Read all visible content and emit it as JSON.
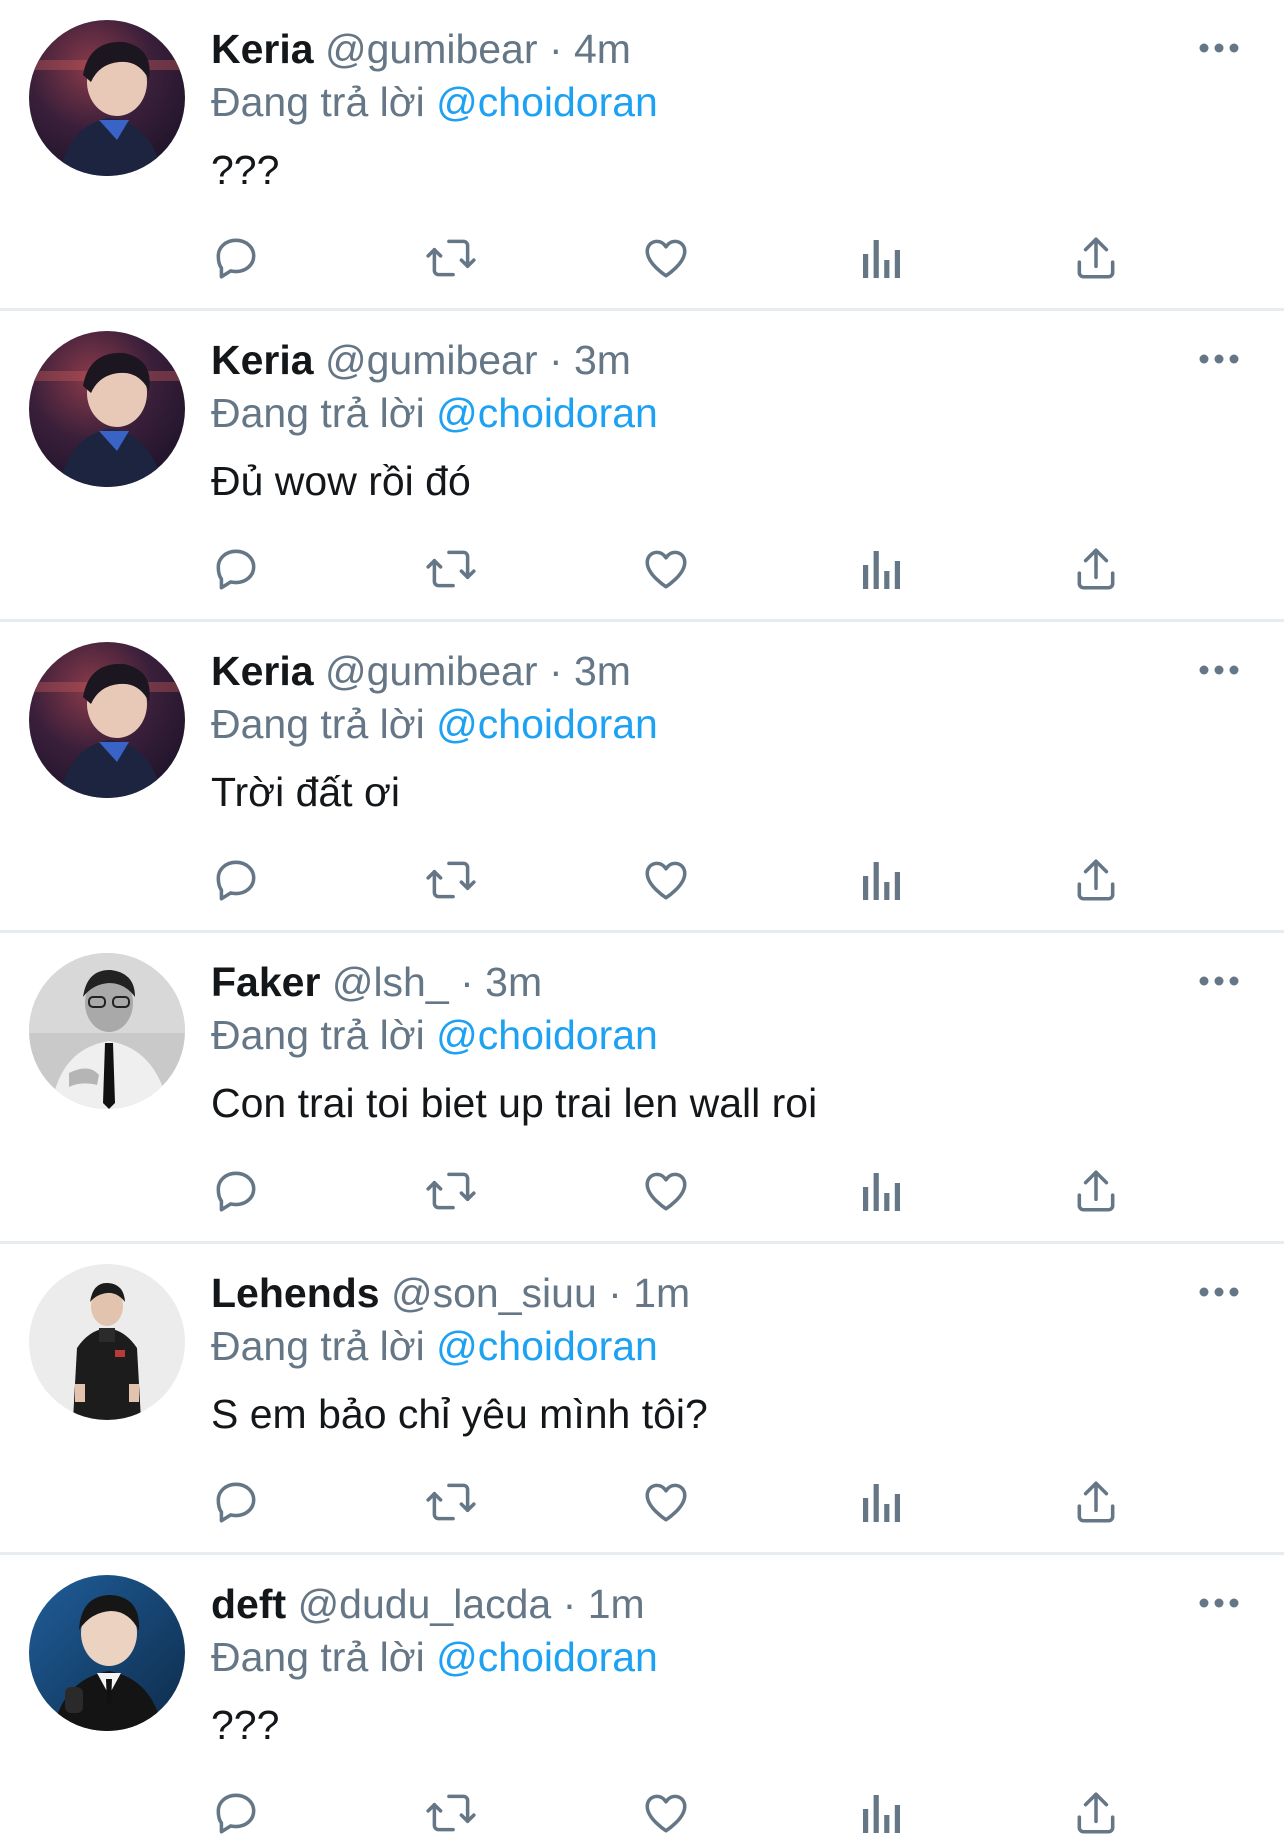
{
  "colors": {
    "name": "#14171a",
    "secondary": "#657786",
    "mention": "#1da1f2",
    "divider": "#e6ecf0",
    "icon": "#657786"
  },
  "icons": {
    "more": "more-horizontal-icon",
    "reply": "reply-bubble-icon",
    "retweet": "retweet-icon",
    "like": "heart-icon",
    "views": "views-bar-chart-icon",
    "share": "share-upload-icon"
  },
  "tweets": [
    {
      "name": "Keria",
      "handle": "@gumibear",
      "sep": "·",
      "time": "4m",
      "reply_prefix": "Đang trả lời",
      "reply_to": "@choidoran",
      "text": "???"
    },
    {
      "name": "Keria",
      "handle": "@gumibear",
      "sep": "·",
      "time": "3m",
      "reply_prefix": "Đang trả lời",
      "reply_to": "@choidoran",
      "text": "Đủ wow rồi đó"
    },
    {
      "name": "Keria",
      "handle": "@gumibear",
      "sep": "·",
      "time": "3m",
      "reply_prefix": "Đang trả lời",
      "reply_to": "@choidoran",
      "text": "Trời đất ơi"
    },
    {
      "name": "Faker",
      "handle": "@lsh_",
      "sep": "·",
      "time": "3m",
      "reply_prefix": "Đang trả lời",
      "reply_to": "@choidoran",
      "text": "Con trai toi biet up trai len wall roi"
    },
    {
      "name": "Lehends",
      "handle": "@son_siuu",
      "sep": "·",
      "time": "1m",
      "reply_prefix": "Đang trả lời",
      "reply_to": "@choidoran",
      "text": "S em bảo chỉ yêu mình tôi?"
    },
    {
      "name": "deft",
      "handle": "@dudu_lacda",
      "sep": "·",
      "time": "1m",
      "reply_prefix": "Đang trả lời",
      "reply_to": "@choidoran",
      "text": "???"
    }
  ]
}
